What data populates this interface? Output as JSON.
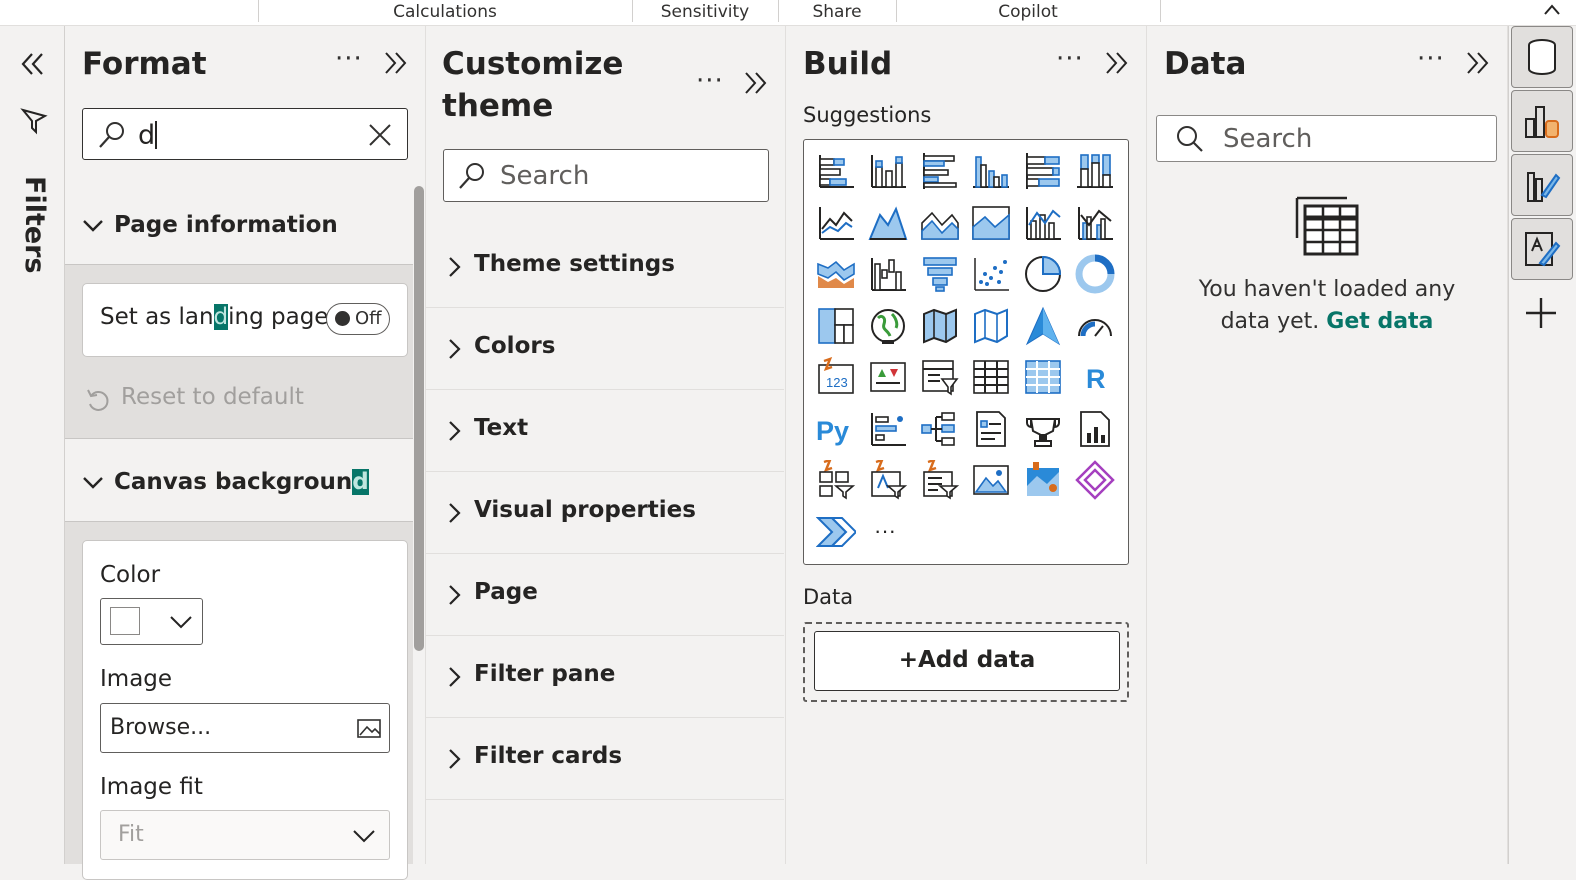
{
  "ribbon": {
    "groups": [
      "Calculations",
      "Sensitivity",
      "Share",
      "Copilot"
    ]
  },
  "filters_strip": {
    "label": "Filters"
  },
  "format": {
    "title": "Format",
    "search_value": "d",
    "page_information": {
      "header": "Page information",
      "landing_label_pre": "Set as lan",
      "landing_label_hl": "d",
      "landing_label_post": "ing page",
      "toggle_label": "Off",
      "reset_label": "Reset to default"
    },
    "canvas_background": {
      "header_pre": "Canvas backgroun",
      "header_hl": "d",
      "color_label": "Color",
      "color_value": "#ffffff",
      "image_label": "Image",
      "image_value": "Browse...",
      "image_fit_label": "Image fit",
      "image_fit_value": "Fit"
    }
  },
  "customize_theme": {
    "title_line1": "Customize",
    "title_line2": "theme",
    "search_placeholder": "Search",
    "items": [
      "Theme settings",
      "Colors",
      "Text",
      "Visual properties",
      "Page",
      "Filter pane",
      "Filter cards"
    ]
  },
  "build": {
    "title": "Build",
    "suggestions_label": "Suggestions",
    "visuals": [
      "stacked-bar-chart-icon",
      "stacked-column-chart-icon",
      "clustered-bar-chart-icon",
      "clustered-column-chart-icon",
      "100-stacked-bar-chart-icon",
      "100-stacked-column-chart-icon",
      "line-chart-icon",
      "area-chart-icon",
      "stacked-area-chart-icon",
      "100-stacked-area-chart-icon",
      "line-and-stacked-column-chart-icon",
      "line-and-clustered-column-chart-icon",
      "ribbon-chart-icon",
      "waterfall-chart-icon",
      "funnel-chart-icon",
      "scatter-chart-icon",
      "pie-chart-icon",
      "donut-chart-icon",
      "treemap-icon",
      "map-icon",
      "filled-map-icon",
      "shape-map-icon",
      "azure-map-icon",
      "gauge-icon",
      "card-icon",
      "kpi-icon",
      "slicer-icon",
      "table-icon",
      "matrix-icon",
      "r-visual-icon",
      "python-visual-icon",
      "key-influencers-icon",
      "decomposition-tree-icon",
      "qa-icon",
      "narrative-icon",
      "paginated-report-icon",
      "button-slicer-icon",
      "text-slicer-icon",
      "list-slicer-icon",
      "image-icon",
      "arcgis-map-icon",
      "power-apps-icon",
      "power-automate-icon",
      "more-visuals-icon"
    ],
    "python_label": "Py",
    "r_label": "R",
    "card_label": "123",
    "more_label": "···",
    "data_label": "Data",
    "add_data_label": "+Add data"
  },
  "data": {
    "title": "Data",
    "search_placeholder": "Search",
    "empty_line1": "You haven't loaded any",
    "empty_line2_pre": "data yet.",
    "empty_link": "Get data"
  },
  "right_rail": {
    "buttons": [
      "data-cylinder-icon",
      "build-visual-icon",
      "format-brush-icon",
      "customize-theme-icon",
      "add-pane-icon"
    ]
  },
  "colors": {
    "accent": "#077568",
    "icon_blue": "#1e6ec4",
    "icon_orange": "#d86c1c"
  }
}
